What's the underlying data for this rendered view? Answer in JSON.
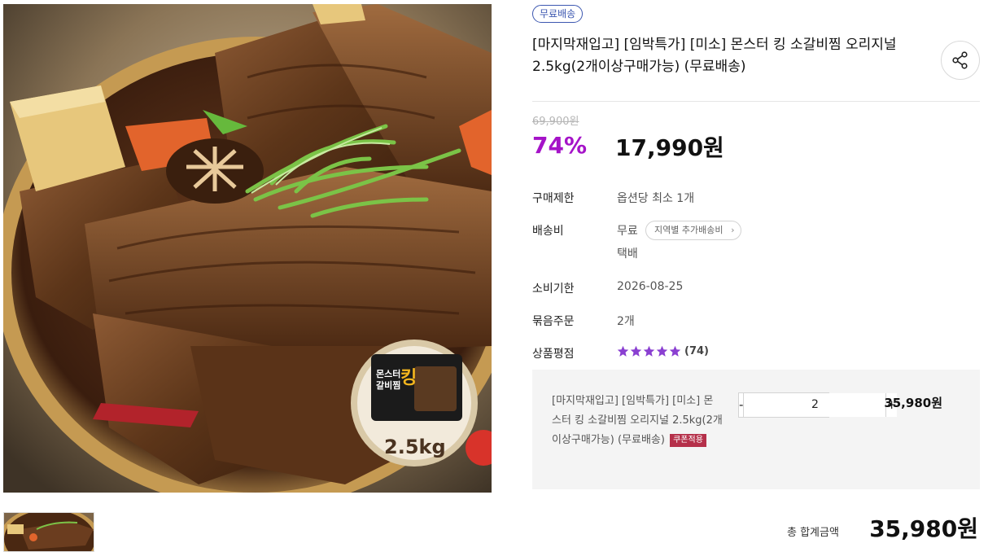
{
  "product": {
    "badge": "무료배송",
    "title": "[마지막재입고] [임박특가] [미소] 몬스터 킹 소갈비찜 오리지널 2.5kg(2개이상구매가능) (무료배송)",
    "image_package_text": {
      "name_line1": "몬스터",
      "name_line2": "갈비찜",
      "king": "킹",
      "weight": "2.5kg"
    }
  },
  "price": {
    "original": "69,900원",
    "discount": "74%",
    "sale": "17,990원"
  },
  "details": {
    "limit_label": "구매제한",
    "limit_value": "옵션당 최소 1개",
    "shipping_label": "배송비",
    "shipping_value": "무료",
    "region_chip": "지역별 추가배송비",
    "shipping_method": "택배",
    "expiry_label": "소비기한",
    "expiry_value": "2026-08-25",
    "bundle_label": "묶음주문",
    "bundle_value": "2개",
    "rating_label": "상품평점",
    "rating_count": "(74)",
    "rating_stars": 5
  },
  "option": {
    "name": "[마지막재입고] [임박특가] [미소] 몬스터 킹 소갈비찜 오리지널 2.5kg(2개이상구매가능) (무료배송)",
    "coupon": "쿠폰적용",
    "minus": "-",
    "plus": "+",
    "quantity": "2",
    "price": "35,980원"
  },
  "total": {
    "label": "총 합계금액",
    "value": "35,980원"
  },
  "colors": {
    "accent": "#a513c8",
    "badge_blue": "#3c57b0",
    "coupon_red": "#b5304a",
    "star": "#8a3fd1"
  }
}
